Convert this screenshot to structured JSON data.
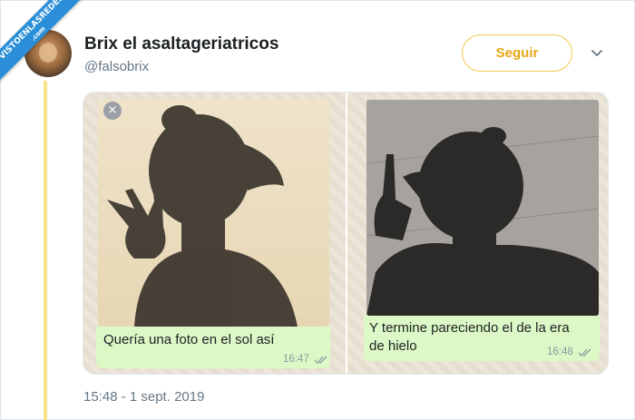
{
  "watermark": {
    "text": "VISTOENLASREDES",
    "subtext": ".com"
  },
  "tweet": {
    "display_name": "Brix el asaltageriatricos",
    "handle": "@falsobrix",
    "follow_label": "Seguir",
    "timestamp": "15:48 - 1 sept. 2019"
  },
  "images": [
    {
      "message": "Quería una foto en el sol así",
      "time": "16:47",
      "close_icon": "×"
    },
    {
      "message_line1": "Y termine pareciendo el de la era",
      "message_line2": "de hielo",
      "time": "16:48"
    }
  ],
  "colors": {
    "accent": "#f2c94c",
    "follow_text": "#e6a817",
    "bubble": "#dcf8c6",
    "watermark": "#2a8fd8"
  },
  "icons": [
    "chevron-down-icon",
    "close-icon",
    "double-check-icon"
  ]
}
